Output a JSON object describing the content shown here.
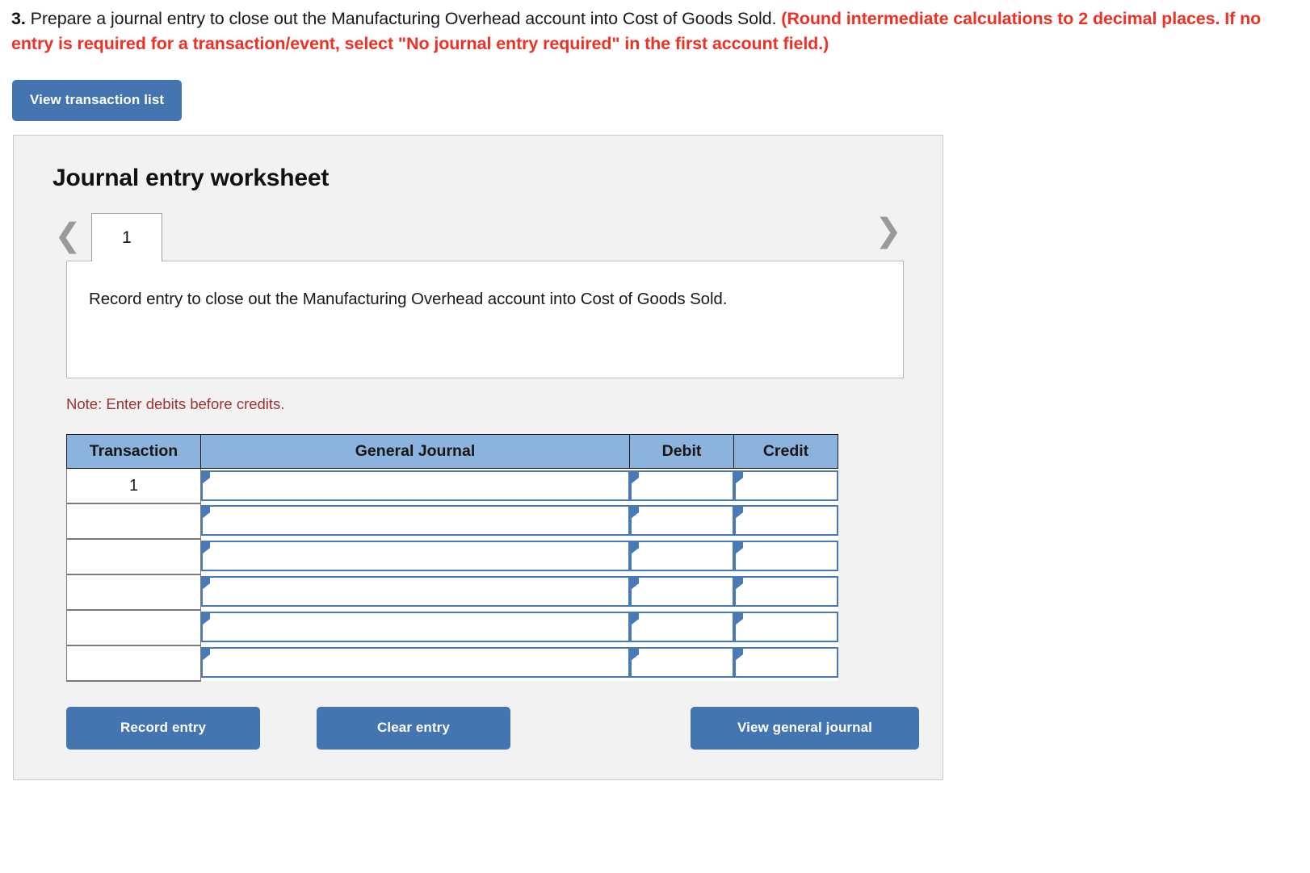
{
  "prompt": {
    "number": "3.",
    "text": " Prepare a journal entry to close out the Manufacturing Overhead account into Cost of Goods Sold. ",
    "red_note": "(Round intermediate calculations to 2 decimal places. If no entry is required for a transaction/event, select \"No journal entry required\" in the first account field.)"
  },
  "toolbar": {
    "view_transaction_list": "View transaction list"
  },
  "worksheet": {
    "title": "Journal entry worksheet",
    "prev_icon": "chevron-left-icon",
    "next_icon": "chevron-right-icon",
    "tabs": [
      {
        "label": "1"
      }
    ],
    "description": "Record entry to close out the Manufacturing Overhead account into Cost of Goods Sold.",
    "note": "Note: Enter debits before credits."
  },
  "table": {
    "headers": [
      "Transaction",
      "General Journal",
      "Debit",
      "Credit"
    ],
    "rows": [
      {
        "transaction": "1",
        "general_journal": "",
        "debit": "",
        "credit": ""
      },
      {
        "transaction": "",
        "general_journal": "",
        "debit": "",
        "credit": ""
      },
      {
        "transaction": "",
        "general_journal": "",
        "debit": "",
        "credit": ""
      },
      {
        "transaction": "",
        "general_journal": "",
        "debit": "",
        "credit": ""
      },
      {
        "transaction": "",
        "general_journal": "",
        "debit": "",
        "credit": ""
      },
      {
        "transaction": "",
        "general_journal": "",
        "debit": "",
        "credit": ""
      }
    ]
  },
  "footer": {
    "record_entry": "Record entry",
    "clear_entry": "Clear entry",
    "view_general_journal": "View general journal"
  },
  "colors": {
    "button_blue": "#4475b0",
    "header_blue": "#8cb3de",
    "red_text": "#ef3124",
    "note_red": "#a03030",
    "panel_bg": "#f2f2f2",
    "input_border": "#4a7ab4"
  }
}
